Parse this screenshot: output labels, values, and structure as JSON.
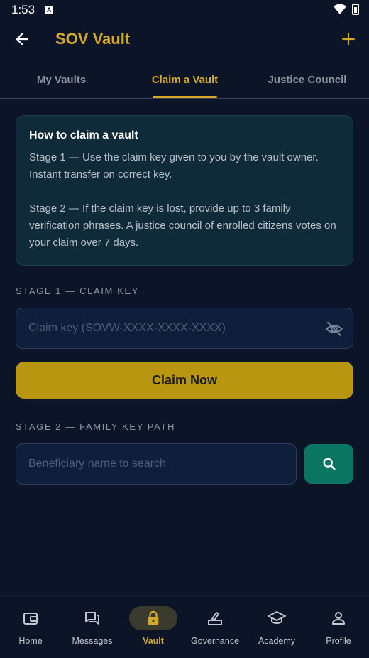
{
  "status": {
    "time": "1:53"
  },
  "appbar": {
    "title": "SOV Vault"
  },
  "tabs": [
    {
      "label": "My Vaults"
    },
    {
      "label": "Claim a Vault"
    },
    {
      "label": "Justice Council"
    }
  ],
  "active_tab": "Claim a Vault",
  "info": {
    "title": "How to claim a vault",
    "stage1": "Stage 1 — Use the claim key given to you by the vault owner. Instant transfer on correct key.",
    "stage2": "Stage 2 — If the claim key is lost, provide up to 3 family verification phrases. A justice council of enrolled citizens votes on your claim over 7 days."
  },
  "stage1": {
    "label": "STAGE 1 — CLAIM KEY",
    "placeholder": "Claim key (SOVW-XXXX-XXXX-XXXX)",
    "value": "",
    "button": "Claim Now"
  },
  "stage2": {
    "label": "STAGE 2 — FAMILY KEY PATH",
    "placeholder": "Beneficiary name to search",
    "value": ""
  },
  "nav": [
    {
      "label": "Home",
      "icon": "wallet-icon"
    },
    {
      "label": "Messages",
      "icon": "chat-icon"
    },
    {
      "label": "Vault",
      "icon": "lock-icon"
    },
    {
      "label": "Governance",
      "icon": "vote-icon"
    },
    {
      "label": "Academy",
      "icon": "graduation-cap-icon"
    },
    {
      "label": "Profile",
      "icon": "person-icon"
    }
  ],
  "active_nav": "Vault",
  "colors": {
    "background": "#0c1428",
    "accent_gold": "#d4a82a",
    "claim_button": "#b8960f",
    "search_button": "#0a7560",
    "info_card": "#0f2a38"
  }
}
